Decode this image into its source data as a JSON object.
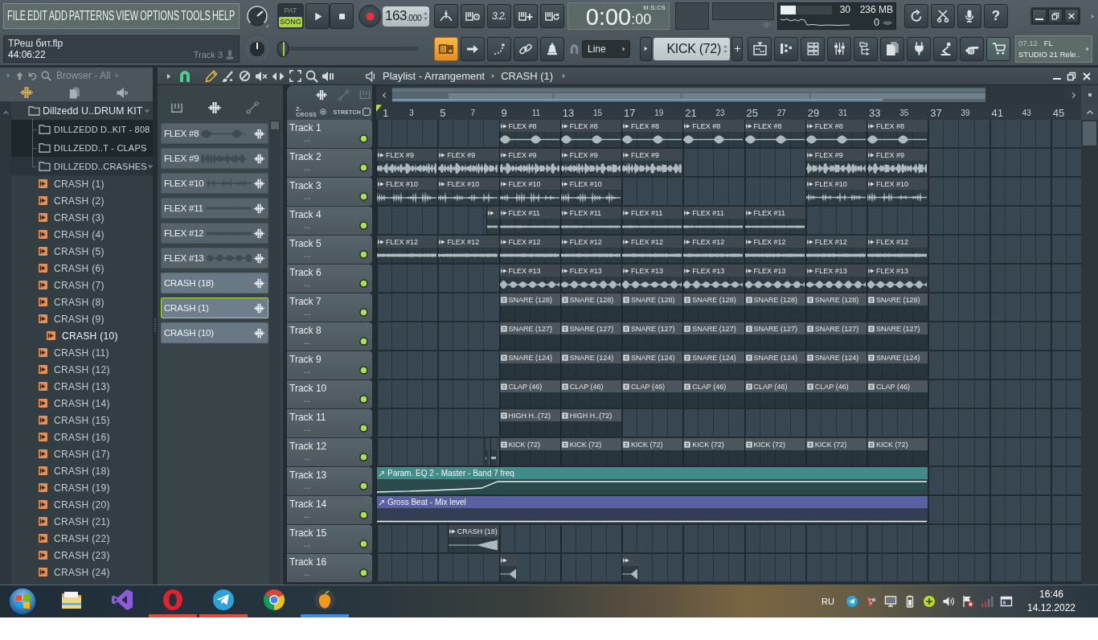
{
  "menu": [
    "FILE",
    "EDIT",
    "ADD",
    "PATTERNS",
    "VIEW",
    "OPTIONS",
    "TOOLS",
    "HELP"
  ],
  "project": {
    "file_name": "ТРеш бит.flp",
    "duration": "44:06:22",
    "hint": "Track 3"
  },
  "mode_toggle": [
    {
      "label": "PAT",
      "selected": false
    },
    {
      "label": "SONG",
      "selected": true
    }
  ],
  "tempo": {
    "whole": "163",
    "fraction": ".000"
  },
  "record_toggles": [
    {
      "kind": "bend",
      "on": false
    },
    {
      "kind": "wait",
      "on": false
    },
    {
      "kind": "countdown",
      "label": "3.2.",
      "on": false
    },
    {
      "kind": "step",
      "on": false
    },
    {
      "kind": "loop",
      "on": false
    }
  ],
  "clock": {
    "reading": "0:00",
    "centiseconds": ":00",
    "format": "M:S:CS"
  },
  "monitor": {
    "cpu": "30",
    "cpu_meter": {
      "level": 0.3
    },
    "memory": "236 MB",
    "polyphony": "0"
  },
  "help_button": "?",
  "position_slider": {
    "level": 0
  },
  "edit_toggles": [
    {
      "kind": "typing",
      "on": true
    },
    {
      "kind": "arrow",
      "on": false
    },
    {
      "kind": "step",
      "on": false
    },
    {
      "kind": "link",
      "on": false
    },
    {
      "kind": "metronome",
      "on": false
    }
  ],
  "snap": "Line",
  "pattern": "KICK (72)",
  "news": {
    "date": "07.12",
    "title_lines": [
      "FL",
      "STUDIO 21 Rele.."
    ]
  },
  "browser": {
    "title": "Browser - All",
    "tree": [
      {
        "label": "Dillzedd U..DRUM KIT",
        "kind": "folder",
        "expanded": true,
        "selected": false,
        "children": [
          {
            "label": "DILLZEDD D..KIT - 808",
            "kind": "folder",
            "expanded": false,
            "selected": false
          },
          {
            "label": "DILLZEDD..T - CLAPS",
            "kind": "folder",
            "expanded": false,
            "selected": false
          },
          {
            "label": "DILLZEDD..CRASHES",
            "kind": "folder",
            "expanded": true,
            "selected": false,
            "children": [
              {
                "label": "CRASH (1)",
                "kind": "sample",
                "selected": false
              },
              {
                "label": "CRASH (2)",
                "kind": "sample",
                "selected": false
              },
              {
                "label": "CRASH (3)",
                "kind": "sample",
                "selected": false
              },
              {
                "label": "CRASH (4)",
                "kind": "sample",
                "selected": false
              },
              {
                "label": "CRASH (5)",
                "kind": "sample",
                "selected": false
              },
              {
                "label": "CRASH (6)",
                "kind": "sample",
                "selected": false
              },
              {
                "label": "CRASH (7)",
                "kind": "sample",
                "selected": false
              },
              {
                "label": "CRASH (8)",
                "kind": "sample",
                "selected": false
              },
              {
                "label": "CRASH (9)",
                "kind": "sample",
                "selected": false
              },
              {
                "label": "CRASH (10)",
                "kind": "sample",
                "selected": true
              },
              {
                "label": "CRASH (11)",
                "kind": "sample",
                "selected": false
              },
              {
                "label": "CRASH (12)",
                "kind": "sample",
                "selected": false
              },
              {
                "label": "CRASH (13)",
                "kind": "sample",
                "selected": false
              },
              {
                "label": "CRASH (14)",
                "kind": "sample",
                "selected": false
              },
              {
                "label": "CRASH (15)",
                "kind": "sample",
                "selected": false
              },
              {
                "label": "CRASH (16)",
                "kind": "sample",
                "selected": false
              },
              {
                "label": "CRASH (17)",
                "kind": "sample",
                "selected": false
              },
              {
                "label": "CRASH (18)",
                "kind": "sample",
                "selected": false
              },
              {
                "label": "CRASH (19)",
                "kind": "sample",
                "selected": false
              },
              {
                "label": "CRASH (20)",
                "kind": "sample",
                "selected": false
              },
              {
                "label": "CRASH (21)",
                "kind": "sample",
                "selected": false
              },
              {
                "label": "CRASH (22)",
                "kind": "sample",
                "selected": false
              },
              {
                "label": "CRASH (23)",
                "kind": "sample",
                "selected": false
              },
              {
                "label": "CRASH (24)",
                "kind": "sample",
                "selected": false
              }
            ]
          }
        ]
      }
    ]
  },
  "playlist": {
    "title": "Playlist - Arrangement",
    "current_clip": "CRASH (1)",
    "sources": [
      {
        "label": "FLEX #8",
        "kind": "flex",
        "selected": false
      },
      {
        "label": "FLEX #9",
        "kind": "flex",
        "selected": false
      },
      {
        "label": "FLEX #10",
        "kind": "flex",
        "selected": false
      },
      {
        "label": "FLEX #11",
        "kind": "flex",
        "selected": false
      },
      {
        "label": "FLEX #12",
        "kind": "flex",
        "selected": false
      },
      {
        "label": "FLEX #13",
        "kind": "flex",
        "selected": false
      },
      {
        "label": "CRASH (18)",
        "kind": "sample",
        "selected": false
      },
      {
        "label": "CRASH (1)",
        "kind": "sample",
        "selected": true
      },
      {
        "label": "CRASH (10)",
        "kind": "sample",
        "selected": false
      }
    ],
    "options": [
      {
        "label": "Z-CROSS",
        "kind": "radio",
        "on": true
      },
      {
        "label": "STRETCH",
        "kind": "checkbox",
        "on": false
      }
    ],
    "ruler": [
      "1",
      "3",
      "5",
      "7",
      "9",
      "11",
      "13",
      "15",
      "17",
      "19",
      "21",
      "23",
      "25",
      "27",
      "29",
      "31",
      "33",
      "35",
      "37",
      "39",
      "41",
      "43",
      "45"
    ],
    "tracks": [
      {
        "name": "Track 1",
        "options": "...",
        "enabled": true,
        "clips": [
          {
            "label": "FLEX #8",
            "kind": "audio"
          },
          {
            "label": "FLEX #8",
            "kind": "audio"
          },
          {
            "label": "FLEX #8",
            "kind": "audio"
          },
          {
            "label": "FLEX #8",
            "kind": "audio"
          },
          {
            "label": "FLEX #8",
            "kind": "audio"
          },
          {
            "label": "FLEX #8",
            "kind": "audio"
          },
          {
            "label": "FLEX #8",
            "kind": "audio"
          }
        ]
      },
      {
        "name": "Track 2",
        "options": "...",
        "enabled": true,
        "clips": [
          {
            "label": "FLEX #9",
            "kind": "audio"
          },
          {
            "label": "FLEX #9",
            "kind": "audio"
          },
          {
            "label": "FLEX #9",
            "kind": "audio"
          },
          {
            "label": "FLEX #9",
            "kind": "audio"
          },
          {
            "label": "FLEX #9",
            "kind": "audio"
          },
          {
            "label": "FLEX #9",
            "kind": "audio"
          },
          {
            "label": "FLEX #9",
            "kind": "audio"
          }
        ]
      },
      {
        "name": "Track 3",
        "options": "...",
        "enabled": true,
        "clips": [
          {
            "label": "FLEX #10",
            "kind": "audio"
          },
          {
            "label": "FLEX #10",
            "kind": "audio"
          },
          {
            "label": "FLEX #10",
            "kind": "audio"
          },
          {
            "label": "FLEX #10",
            "kind": "audio"
          },
          {
            "label": "FLEX #10",
            "kind": "audio"
          },
          {
            "label": "FLEX #10",
            "kind": "audio"
          }
        ]
      },
      {
        "name": "Track 4",
        "options": "...",
        "enabled": true,
        "clips": [
          {
            "kind": "audio"
          },
          {
            "label": "FLEX #11",
            "kind": "audio"
          },
          {
            "label": "FLEX #11",
            "kind": "audio"
          },
          {
            "label": "FLEX #11",
            "kind": "audio"
          },
          {
            "label": "FLEX #11",
            "kind": "audio"
          },
          {
            "label": "FLEX #11",
            "kind": "audio"
          }
        ]
      },
      {
        "name": "Track 5",
        "options": "...",
        "enabled": true,
        "clips": [
          {
            "label": "FLEX #12",
            "kind": "audio"
          },
          {
            "label": "FLEX #12",
            "kind": "audio"
          },
          {
            "label": "FLEX #12",
            "kind": "audio"
          },
          {
            "label": "FLEX #12",
            "kind": "audio"
          },
          {
            "label": "FLEX #12",
            "kind": "audio"
          },
          {
            "label": "FLEX #12",
            "kind": "audio"
          },
          {
            "label": "FLEX #12",
            "kind": "audio"
          },
          {
            "label": "FLEX #12",
            "kind": "audio"
          },
          {
            "label": "FLEX #12",
            "kind": "audio"
          }
        ]
      },
      {
        "name": "Track 6",
        "options": "...",
        "enabled": true,
        "clips": [
          {
            "label": "FLEX #13",
            "kind": "audio"
          },
          {
            "label": "FLEX #13",
            "kind": "audio"
          },
          {
            "label": "FLEX #13",
            "kind": "audio"
          },
          {
            "label": "FLEX #13",
            "kind": "audio"
          },
          {
            "label": "FLEX #13",
            "kind": "audio"
          },
          {
            "label": "FLEX #13",
            "kind": "audio"
          },
          {
            "label": "FLEX #13",
            "kind": "audio"
          }
        ]
      },
      {
        "name": "Track 7",
        "options": "...",
        "enabled": true,
        "clips": [
          {
            "label": "SNARE (128)",
            "kind": "pattern"
          },
          {
            "label": "SNARE (128)",
            "kind": "pattern"
          },
          {
            "label": "SNARE (128)",
            "kind": "pattern"
          },
          {
            "label": "SNARE (128)",
            "kind": "pattern"
          },
          {
            "label": "SNARE (128)",
            "kind": "pattern"
          },
          {
            "label": "SNARE (128)",
            "kind": "pattern"
          },
          {
            "label": "SNARE (128)",
            "kind": "pattern"
          }
        ]
      },
      {
        "name": "Track 8",
        "options": "...",
        "enabled": true,
        "clips": [
          {
            "label": "SNARE (127)",
            "kind": "pattern"
          },
          {
            "label": "SNARE (127)",
            "kind": "pattern"
          },
          {
            "label": "SNARE (127)",
            "kind": "pattern"
          },
          {
            "label": "SNARE (127)",
            "kind": "pattern"
          },
          {
            "label": "SNARE (127)",
            "kind": "pattern"
          },
          {
            "label": "SNARE (127)",
            "kind": "pattern"
          },
          {
            "label": "SNARE (127)",
            "kind": "pattern"
          }
        ]
      },
      {
        "name": "Track 9",
        "options": "...",
        "enabled": true,
        "clips": [
          {
            "label": "SNARE (124)",
            "kind": "pattern"
          },
          {
            "label": "SNARE (124)",
            "kind": "pattern"
          },
          {
            "label": "SNARE (124)",
            "kind": "pattern"
          },
          {
            "label": "SNARE (124)",
            "kind": "pattern"
          },
          {
            "label": "SNARE (124)",
            "kind": "pattern"
          },
          {
            "label": "SNARE (124)",
            "kind": "pattern"
          },
          {
            "label": "SNARE (124)",
            "kind": "pattern"
          }
        ]
      },
      {
        "name": "Track 10",
        "options": "...",
        "enabled": true,
        "clips": [
          {
            "label": "CLAP (46)",
            "kind": "pattern"
          },
          {
            "label": "CLAP (46)",
            "kind": "pattern"
          },
          {
            "label": "CLAP (46)",
            "kind": "pattern"
          },
          {
            "label": "CLAP (46)",
            "kind": "pattern"
          },
          {
            "label": "CLAP (46)",
            "kind": "pattern"
          },
          {
            "label": "CLAP (46)",
            "kind": "pattern"
          },
          {
            "label": "CLAP (46)",
            "kind": "pattern"
          }
        ]
      },
      {
        "name": "Track 11",
        "options": "...",
        "enabled": true,
        "clips": [
          {
            "label": "HIGH H..(72)",
            "kind": "pattern"
          },
          {
            "label": "HIGH H..(72)",
            "kind": "pattern"
          }
        ]
      },
      {
        "name": "Track 12",
        "options": "...",
        "enabled": true,
        "clips": [
          {
            "kind": "audio"
          },
          {
            "kind": "audio"
          },
          {
            "label": "KICK (72)",
            "kind": "pattern"
          },
          {
            "label": "KICK (72)",
            "kind": "pattern"
          },
          {
            "label": "KICK (72)",
            "kind": "pattern"
          },
          {
            "label": "KICK (72)",
            "kind": "pattern"
          },
          {
            "label": "KICK (72)",
            "kind": "pattern"
          },
          {
            "label": "KICK (72)",
            "kind": "pattern"
          },
          {
            "label": "KICK (72)",
            "kind": "pattern"
          }
        ]
      },
      {
        "name": "Track 13",
        "options": "...",
        "enabled": true,
        "clips": [
          {
            "label": "Param. EQ 2 - Master - Band 7 freq",
            "kind": "automation",
            "color": "#3f8c88"
          }
        ]
      },
      {
        "name": "Track 14",
        "options": "...",
        "enabled": true,
        "clips": [
          {
            "label": "Gross Beat - Mix level",
            "kind": "automation",
            "color": "#5a61a3"
          }
        ]
      },
      {
        "name": "Track 15",
        "options": "...",
        "enabled": true,
        "clips": [
          {
            "label": "CRASH (18)",
            "kind": "audio"
          }
        ]
      },
      {
        "name": "Track 16",
        "options": "...",
        "enabled": true,
        "clips": [
          {
            "kind": "audio"
          },
          {
            "kind": "audio"
          }
        ]
      }
    ]
  },
  "taskbar": {
    "apps": [
      {
        "kind": "start"
      },
      {
        "kind": "folder",
        "alert": false,
        "active": false
      },
      {
        "kind": "bow",
        "alert": false,
        "active": false
      },
      {
        "kind": "ring",
        "alert": true,
        "active": false
      },
      {
        "kind": "plane",
        "alert": true,
        "active": false
      },
      {
        "kind": "wheel",
        "alert": false,
        "active": false
      },
      {
        "kind": "fruit",
        "alert": false,
        "active": true
      }
    ],
    "language": "RU",
    "time": "16:46",
    "date": "14.12.2022"
  }
}
